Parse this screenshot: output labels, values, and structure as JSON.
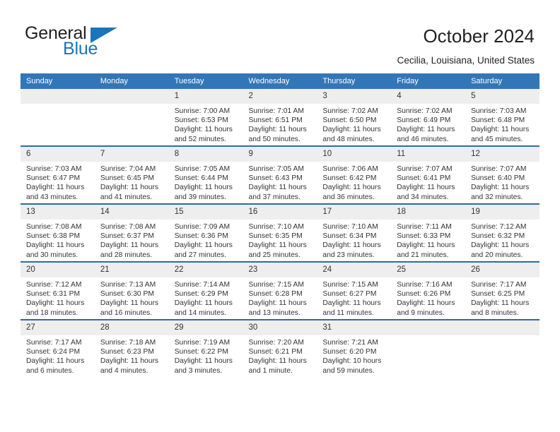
{
  "logo": {
    "word_top": "General",
    "word_bottom": "Blue",
    "triangle_icon": "blue-triangle-icon",
    "brand_color": "#1b75bb"
  },
  "header": {
    "title": "October 2024",
    "subtitle": "Cecilia, Louisiana, United States"
  },
  "theme": {
    "header_blue": "#3376b8",
    "row_divider_blue": "#2f6aa8",
    "date_band_gray": "#eeeeee",
    "text": "#333333"
  },
  "calendar": {
    "weekday_headers": [
      "Sunday",
      "Monday",
      "Tuesday",
      "Wednesday",
      "Thursday",
      "Friday",
      "Saturday"
    ],
    "labels": {
      "sunrise_prefix": "Sunrise:",
      "sunset_prefix": "Sunset:",
      "daylight_prefix": "Daylight:"
    },
    "weeks": [
      [
        {
          "day": "",
          "empty": true
        },
        {
          "day": "",
          "empty": true
        },
        {
          "day": "1",
          "sunrise": "Sunrise: 7:00 AM",
          "sunset": "Sunset: 6:53 PM",
          "daylight": "Daylight: 11 hours and 52 minutes."
        },
        {
          "day": "2",
          "sunrise": "Sunrise: 7:01 AM",
          "sunset": "Sunset: 6:51 PM",
          "daylight": "Daylight: 11 hours and 50 minutes."
        },
        {
          "day": "3",
          "sunrise": "Sunrise: 7:02 AM",
          "sunset": "Sunset: 6:50 PM",
          "daylight": "Daylight: 11 hours and 48 minutes."
        },
        {
          "day": "4",
          "sunrise": "Sunrise: 7:02 AM",
          "sunset": "Sunset: 6:49 PM",
          "daylight": "Daylight: 11 hours and 46 minutes."
        },
        {
          "day": "5",
          "sunrise": "Sunrise: 7:03 AM",
          "sunset": "Sunset: 6:48 PM",
          "daylight": "Daylight: 11 hours and 45 minutes."
        }
      ],
      [
        {
          "day": "6",
          "sunrise": "Sunrise: 7:03 AM",
          "sunset": "Sunset: 6:47 PM",
          "daylight": "Daylight: 11 hours and 43 minutes."
        },
        {
          "day": "7",
          "sunrise": "Sunrise: 7:04 AM",
          "sunset": "Sunset: 6:45 PM",
          "daylight": "Daylight: 11 hours and 41 minutes."
        },
        {
          "day": "8",
          "sunrise": "Sunrise: 7:05 AM",
          "sunset": "Sunset: 6:44 PM",
          "daylight": "Daylight: 11 hours and 39 minutes."
        },
        {
          "day": "9",
          "sunrise": "Sunrise: 7:05 AM",
          "sunset": "Sunset: 6:43 PM",
          "daylight": "Daylight: 11 hours and 37 minutes."
        },
        {
          "day": "10",
          "sunrise": "Sunrise: 7:06 AM",
          "sunset": "Sunset: 6:42 PM",
          "daylight": "Daylight: 11 hours and 36 minutes."
        },
        {
          "day": "11",
          "sunrise": "Sunrise: 7:07 AM",
          "sunset": "Sunset: 6:41 PM",
          "daylight": "Daylight: 11 hours and 34 minutes."
        },
        {
          "day": "12",
          "sunrise": "Sunrise: 7:07 AM",
          "sunset": "Sunset: 6:40 PM",
          "daylight": "Daylight: 11 hours and 32 minutes."
        }
      ],
      [
        {
          "day": "13",
          "sunrise": "Sunrise: 7:08 AM",
          "sunset": "Sunset: 6:38 PM",
          "daylight": "Daylight: 11 hours and 30 minutes."
        },
        {
          "day": "14",
          "sunrise": "Sunrise: 7:08 AM",
          "sunset": "Sunset: 6:37 PM",
          "daylight": "Daylight: 11 hours and 28 minutes."
        },
        {
          "day": "15",
          "sunrise": "Sunrise: 7:09 AM",
          "sunset": "Sunset: 6:36 PM",
          "daylight": "Daylight: 11 hours and 27 minutes."
        },
        {
          "day": "16",
          "sunrise": "Sunrise: 7:10 AM",
          "sunset": "Sunset: 6:35 PM",
          "daylight": "Daylight: 11 hours and 25 minutes."
        },
        {
          "day": "17",
          "sunrise": "Sunrise: 7:10 AM",
          "sunset": "Sunset: 6:34 PM",
          "daylight": "Daylight: 11 hours and 23 minutes."
        },
        {
          "day": "18",
          "sunrise": "Sunrise: 7:11 AM",
          "sunset": "Sunset: 6:33 PM",
          "daylight": "Daylight: 11 hours and 21 minutes."
        },
        {
          "day": "19",
          "sunrise": "Sunrise: 7:12 AM",
          "sunset": "Sunset: 6:32 PM",
          "daylight": "Daylight: 11 hours and 20 minutes."
        }
      ],
      [
        {
          "day": "20",
          "sunrise": "Sunrise: 7:12 AM",
          "sunset": "Sunset: 6:31 PM",
          "daylight": "Daylight: 11 hours and 18 minutes."
        },
        {
          "day": "21",
          "sunrise": "Sunrise: 7:13 AM",
          "sunset": "Sunset: 6:30 PM",
          "daylight": "Daylight: 11 hours and 16 minutes."
        },
        {
          "day": "22",
          "sunrise": "Sunrise: 7:14 AM",
          "sunset": "Sunset: 6:29 PM",
          "daylight": "Daylight: 11 hours and 14 minutes."
        },
        {
          "day": "23",
          "sunrise": "Sunrise: 7:15 AM",
          "sunset": "Sunset: 6:28 PM",
          "daylight": "Daylight: 11 hours and 13 minutes."
        },
        {
          "day": "24",
          "sunrise": "Sunrise: 7:15 AM",
          "sunset": "Sunset: 6:27 PM",
          "daylight": "Daylight: 11 hours and 11 minutes."
        },
        {
          "day": "25",
          "sunrise": "Sunrise: 7:16 AM",
          "sunset": "Sunset: 6:26 PM",
          "daylight": "Daylight: 11 hours and 9 minutes."
        },
        {
          "day": "26",
          "sunrise": "Sunrise: 7:17 AM",
          "sunset": "Sunset: 6:25 PM",
          "daylight": "Daylight: 11 hours and 8 minutes."
        }
      ],
      [
        {
          "day": "27",
          "sunrise": "Sunrise: 7:17 AM",
          "sunset": "Sunset: 6:24 PM",
          "daylight": "Daylight: 11 hours and 6 minutes."
        },
        {
          "day": "28",
          "sunrise": "Sunrise: 7:18 AM",
          "sunset": "Sunset: 6:23 PM",
          "daylight": "Daylight: 11 hours and 4 minutes."
        },
        {
          "day": "29",
          "sunrise": "Sunrise: 7:19 AM",
          "sunset": "Sunset: 6:22 PM",
          "daylight": "Daylight: 11 hours and 3 minutes."
        },
        {
          "day": "30",
          "sunrise": "Sunrise: 7:20 AM",
          "sunset": "Sunset: 6:21 PM",
          "daylight": "Daylight: 11 hours and 1 minute."
        },
        {
          "day": "31",
          "sunrise": "Sunrise: 7:21 AM",
          "sunset": "Sunset: 6:20 PM",
          "daylight": "Daylight: 10 hours and 59 minutes."
        },
        {
          "day": "",
          "empty": true
        },
        {
          "day": "",
          "empty": true
        }
      ]
    ]
  }
}
